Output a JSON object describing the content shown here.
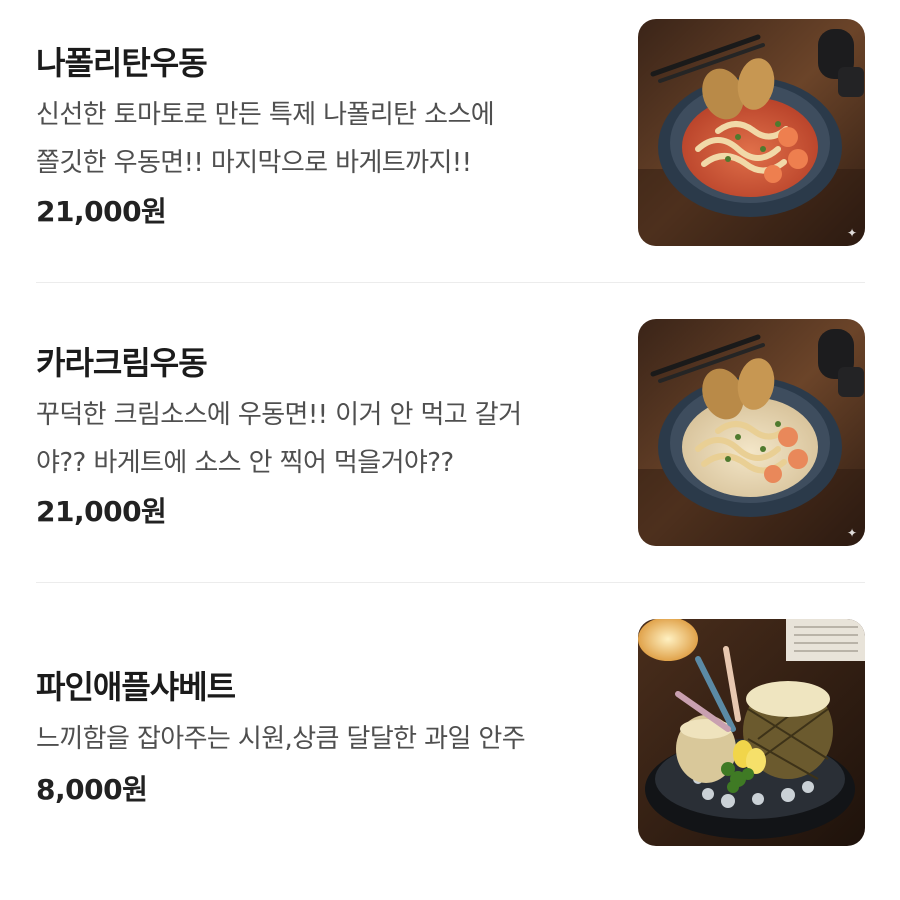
{
  "menu": {
    "items": [
      {
        "name": "나폴리탄우동",
        "description_lines": [
          "신선한 토마토로 만든 특제 나폴리탄 소스에",
          "쫄깃한 우동면!! 마지막으로 바게트까지!!"
        ],
        "price": "21,000원",
        "image_icon": "food-photo-icon"
      },
      {
        "name": "카라크림우동",
        "description_lines": [
          "꾸덕한 크림소스에 우동면!! 이거 안 먹고 갈거",
          "야?? 바게트에 소스 안 찍어 먹을거야??"
        ],
        "price": "21,000원",
        "image_icon": "food-photo-icon"
      },
      {
        "name": "파인애플샤베트",
        "description_lines": [
          "느끼함을 잡아주는 시원,상큼 달달한 과일 안주"
        ],
        "price": "8,000원",
        "image_icon": "food-photo-icon"
      }
    ]
  },
  "colors": {
    "text_primary": "#1b1b1b",
    "text_secondary": "#4f4f4f",
    "divider": "#ececec"
  }
}
